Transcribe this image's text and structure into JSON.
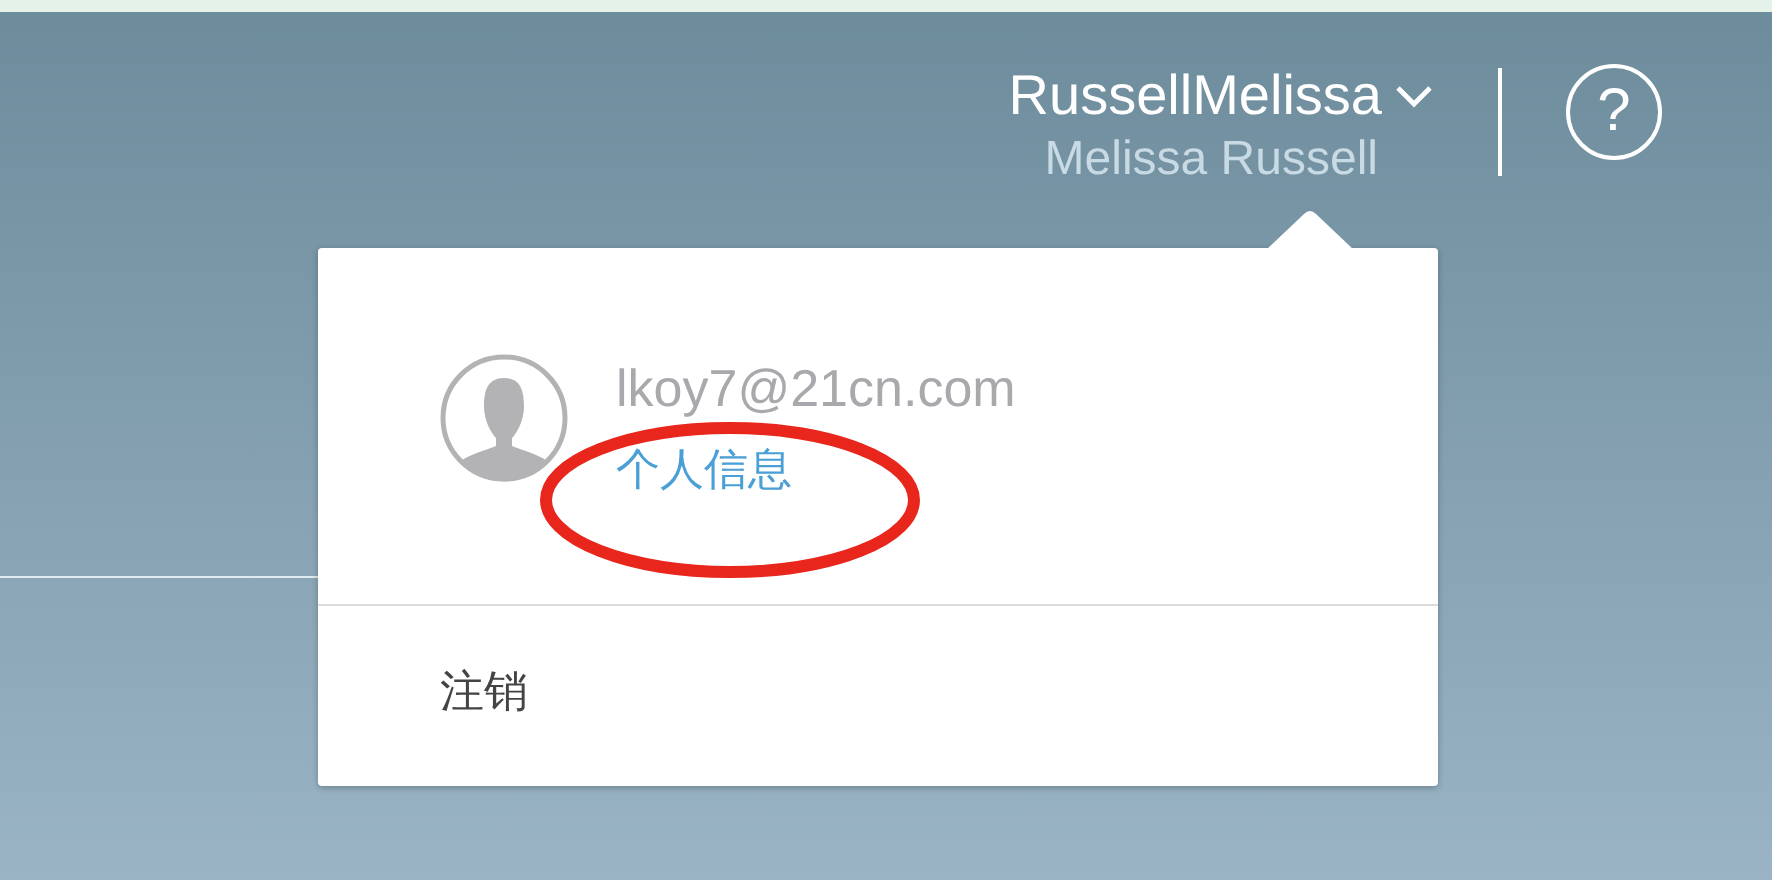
{
  "header": {
    "username": "RussellMelissa",
    "display_name": "Melissa Russell",
    "help": "?"
  },
  "account_menu": {
    "email": "lkoy7@21cn.com",
    "profile_link": "个人信息",
    "logout": "注销"
  }
}
